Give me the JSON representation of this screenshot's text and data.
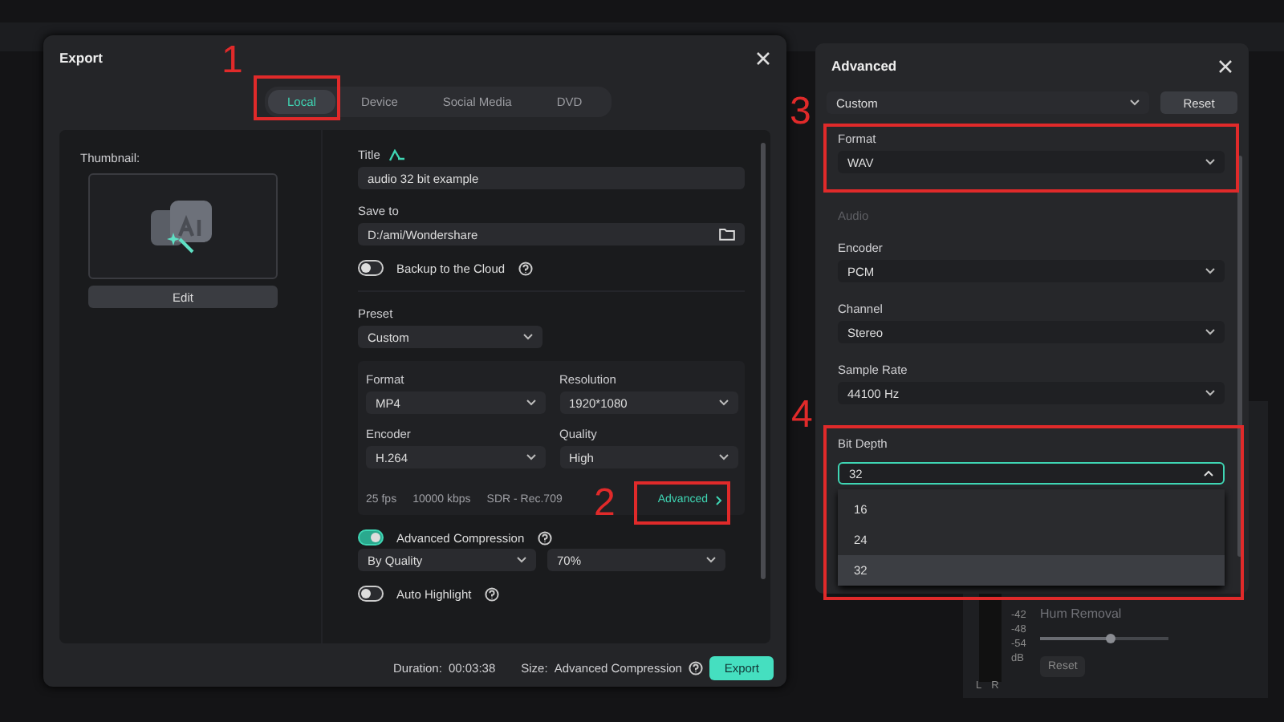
{
  "export_dialog": {
    "title": "Export",
    "tabs": [
      {
        "label": "Local",
        "selected": true
      },
      {
        "label": "Device",
        "selected": false
      },
      {
        "label": "Social Media",
        "selected": false
      },
      {
        "label": "DVD",
        "selected": false
      }
    ],
    "thumbnail": {
      "label": "Thumbnail:",
      "edit_button": "Edit"
    },
    "title_field": {
      "label": "Title",
      "value": "audio 32 bit example"
    },
    "save_to": {
      "label": "Save to",
      "value": "D:/ami/Wondershare"
    },
    "backup": {
      "label": "Backup to the Cloud",
      "on": false
    },
    "preset": {
      "label": "Preset",
      "value": "Custom"
    },
    "settings": [
      {
        "label": "Format",
        "value": "MP4"
      },
      {
        "label": "Resolution",
        "value": "1920*1080"
      },
      {
        "label": "Encoder",
        "value": "H.264"
      },
      {
        "label": "Quality",
        "value": "High"
      }
    ],
    "specs": [
      "25 fps",
      "10000 kbps",
      "SDR - Rec.709"
    ],
    "advanced_link": "Advanced",
    "advanced_compression": {
      "label": "Advanced Compression",
      "on": true,
      "mode": "By Quality",
      "quality": "70%"
    },
    "auto_highlight": {
      "label": "Auto Highlight",
      "on": false
    },
    "footer": {
      "duration_label": "Duration:",
      "duration": "00:03:38",
      "size_label": "Size:",
      "size": "Advanced Compression",
      "export_button": "Export"
    }
  },
  "advanced_panel": {
    "title": "Advanced",
    "preset": "Custom",
    "reset_button": "Reset",
    "format": {
      "label": "Format",
      "value": "WAV"
    },
    "section": "Audio",
    "fields": [
      {
        "label": "Encoder",
        "value": "PCM"
      },
      {
        "label": "Channel",
        "value": "Stereo"
      },
      {
        "label": "Sample Rate",
        "value": "44100 Hz"
      }
    ],
    "bit_depth": {
      "label": "Bit Depth",
      "value": "32",
      "expanded": true,
      "options": [
        {
          "label": "16",
          "selected": false
        },
        {
          "label": "24",
          "selected": false
        },
        {
          "label": "32",
          "selected": true
        }
      ]
    }
  },
  "background_app": {
    "hum_removal": "Hum Removal",
    "hum_slider": {
      "level": 0.55
    },
    "reset_button": "Reset",
    "meter_labels": [
      "-42",
      "-48",
      "-54",
      "dB"
    ],
    "channels": [
      "L",
      "R"
    ]
  },
  "annotations": [
    {
      "label": "1"
    },
    {
      "label": "2"
    },
    {
      "label": "3"
    },
    {
      "label": "4"
    }
  ]
}
